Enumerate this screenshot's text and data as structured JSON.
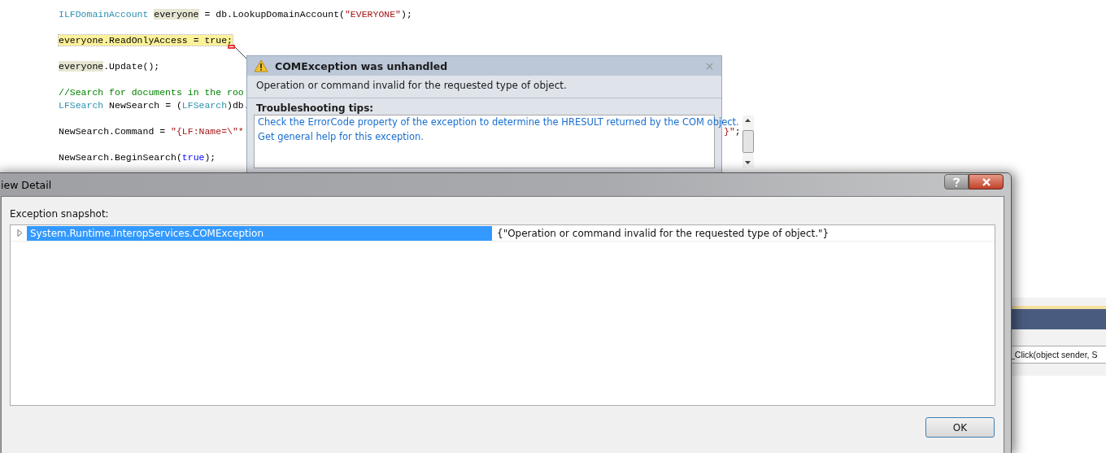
{
  "code_lines": [
    {
      "current": false,
      "tokens": [
        {
          "kind": "type",
          "text": "ILFDomainAccount"
        },
        {
          "kind": "ref",
          "text": "everyone"
        },
        {
          "kind": "plain",
          "text": " = db.LookupDomainAccount("
        },
        {
          "kind": "string",
          "text": "\"EVERYONE\""
        },
        {
          "kind": "plain",
          "text": ");"
        }
      ]
    },
    {
      "current": true,
      "error_mark": true,
      "tokens": [
        {
          "kind": "plain",
          "text": "everyone.ReadOnlyAccess = true;"
        }
      ]
    },
    {
      "current": false,
      "tokens": [
        {
          "kind": "ref",
          "text": "everyone"
        },
        {
          "kind": "plain",
          "text": ".Update();"
        }
      ]
    },
    {
      "current": false,
      "tokens": [
        {
          "kind": "comment",
          "text": "//Search for documents in the roo"
        }
      ]
    },
    {
      "current": false,
      "tokens": [
        {
          "kind": "type",
          "text": "LFSearch"
        },
        {
          "kind": "plain",
          "text": " NewSearch = ("
        },
        {
          "kind": "type",
          "text": "LFSearch"
        },
        {
          "kind": "plain",
          "text": ")db."
        }
      ]
    },
    {
      "current": false,
      "tokens": [
        {
          "kind": "plain",
          "text": "NewSearch.Command = "
        },
        {
          "kind": "string",
          "text": "\"{LF:Name=\\\"*"
        }
      ],
      "tail": [
        {
          "kind": "string",
          "text": "}\""
        },
        {
          "kind": "plain",
          "text": ";"
        }
      ]
    },
    {
      "current": false,
      "tokens": [
        {
          "kind": "plain",
          "text": "NewSearch.BeginSearch("
        },
        {
          "kind": "keyword",
          "text": "true"
        },
        {
          "kind": "plain",
          "text": ");"
        }
      ]
    }
  ],
  "exception_popup": {
    "title": "COMException was unhandled",
    "message": "Operation or command invalid for the requested type of object.",
    "tips_heading": "Troubleshooting tips:",
    "tips": [
      "Check the ErrorCode property of the exception to determine the HRESULT returned by the COM object.",
      "Get general help for this exception."
    ]
  },
  "detail_dialog": {
    "title": "iew Detail",
    "snapshot_label": "Exception snapshot:",
    "rows": [
      {
        "name": "System.Runtime.InteropServices.COMException",
        "value": "{\"Operation or command invalid for the requested type of object.\"}",
        "selected": true,
        "expanded": false
      }
    ],
    "ok_button": "OK"
  },
  "call_stack": {
    "text": "_Click(object sender, S"
  }
}
